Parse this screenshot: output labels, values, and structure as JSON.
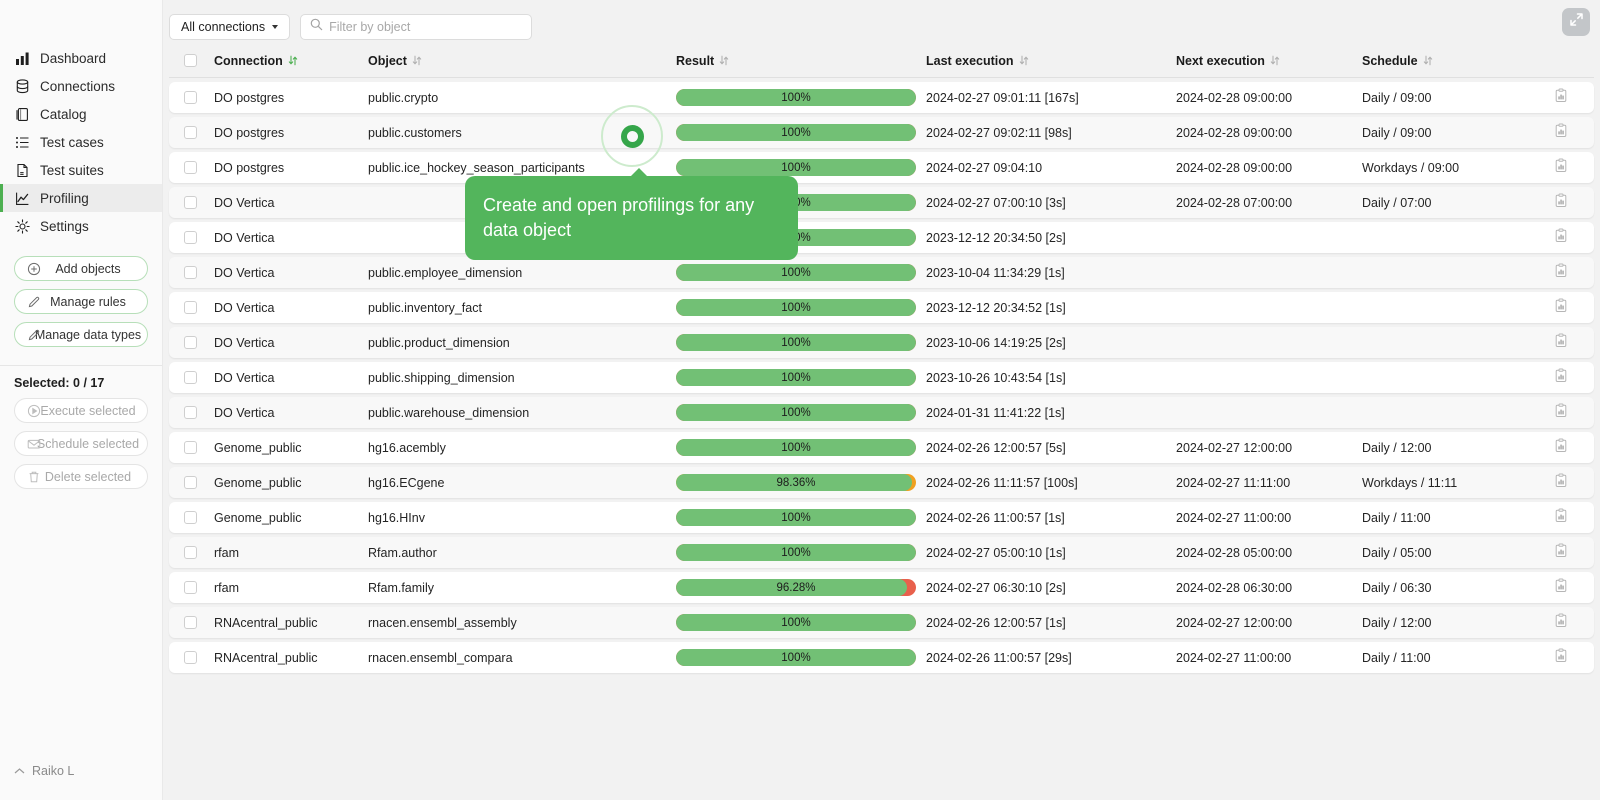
{
  "sidebar": {
    "nav_items": [
      {
        "label": "Dashboard",
        "icon": "bar-chart-icon",
        "active": false
      },
      {
        "label": "Connections",
        "icon": "database-icon",
        "active": false
      },
      {
        "label": "Catalog",
        "icon": "book-icon",
        "active": false
      },
      {
        "label": "Test cases",
        "icon": "list-icon",
        "active": false
      },
      {
        "label": "Test suites",
        "icon": "document-icon",
        "active": false
      },
      {
        "label": "Profiling",
        "icon": "line-chart-icon",
        "active": true
      },
      {
        "label": "Settings",
        "icon": "gear-icon",
        "active": false
      }
    ],
    "actions": [
      {
        "label": "Add objects",
        "icon": "plus-circle-icon",
        "enabled": true
      },
      {
        "label": "Manage rules",
        "icon": "pencil-icon",
        "enabled": true
      },
      {
        "label": "Manage data types",
        "icon": "pencil-icon",
        "enabled": true
      }
    ],
    "selected_label": "Selected: 0 / 17",
    "selection_actions": [
      {
        "label": "Execute selected",
        "icon": "play-circle-icon",
        "enabled": false
      },
      {
        "label": "Schedule selected",
        "icon": "envelope-icon",
        "enabled": false
      },
      {
        "label": "Delete selected",
        "icon": "trash-icon",
        "enabled": false
      }
    ],
    "user": {
      "name": "Raiko L",
      "icon": "chevron-up-icon"
    }
  },
  "toolbar": {
    "connection_filter_label": "All connections",
    "connection_filter_icon": "caret-down-icon",
    "search_placeholder": "Filter by object",
    "search_value": "",
    "search_icon": "search-icon",
    "expand_icon": "expand-icon"
  },
  "table": {
    "columns": [
      {
        "label": "Connection",
        "sort_icon": "sort-updown-icon",
        "sort_active": true
      },
      {
        "label": "Object",
        "sort_icon": "sort-updown-icon",
        "sort_active": false
      },
      {
        "label": "Result",
        "sort_icon": "sort-updown-icon",
        "sort_active": false
      },
      {
        "label": "Last execution",
        "sort_icon": "sort-updown-icon",
        "sort_active": false
      },
      {
        "label": "Next execution",
        "sort_icon": "sort-updown-icon",
        "sort_active": false
      },
      {
        "label": "Schedule",
        "sort_icon": "sort-updown-icon",
        "sort_active": false
      }
    ],
    "select_all_checkbox": false,
    "row_action_icon": "report-icon",
    "rows": [
      {
        "connection": "DO postgres",
        "object": "public.crypto",
        "result": "100%",
        "pct": 100,
        "last_execution": "2024-02-27 09:01:11 [167s]",
        "next_execution": "2024-02-28 09:00:00",
        "schedule": "Daily / 09:00",
        "checked": false
      },
      {
        "connection": "DO postgres",
        "object": "public.customers",
        "result": "100%",
        "pct": 100,
        "last_execution": "2024-02-27 09:02:11 [98s]",
        "next_execution": "2024-02-28 09:00:00",
        "schedule": "Daily / 09:00",
        "checked": false
      },
      {
        "connection": "DO postgres",
        "object": "public.ice_hockey_season_participants",
        "result": "100%",
        "pct": 100,
        "last_execution": "2024-02-27 09:04:10",
        "next_execution": "2024-02-28 09:00:00",
        "schedule": "Workdays / 09:00",
        "checked": false
      },
      {
        "connection": "DO Vertica",
        "object": "",
        "result": "100%",
        "pct": 100,
        "last_execution": "2024-02-27 07:00:10 [3s]",
        "next_execution": "2024-02-28 07:00:00",
        "schedule": "Daily / 07:00",
        "checked": false
      },
      {
        "connection": "DO Vertica",
        "object": "",
        "result": "100%",
        "pct": 100,
        "last_execution": "2023-12-12 20:34:50 [2s]",
        "next_execution": "",
        "schedule": "",
        "checked": false
      },
      {
        "connection": "DO Vertica",
        "object": "public.employee_dimension",
        "result": "100%",
        "pct": 100,
        "last_execution": "2023-10-04 11:34:29 [1s]",
        "next_execution": "",
        "schedule": "",
        "checked": false
      },
      {
        "connection": "DO Vertica",
        "object": "public.inventory_fact",
        "result": "100%",
        "pct": 100,
        "last_execution": "2023-12-12 20:34:52 [1s]",
        "next_execution": "",
        "schedule": "",
        "checked": false
      },
      {
        "connection": "DO Vertica",
        "object": "public.product_dimension",
        "result": "100%",
        "pct": 100,
        "last_execution": "2023-10-06 14:19:25 [2s]",
        "next_execution": "",
        "schedule": "",
        "checked": false
      },
      {
        "connection": "DO Vertica",
        "object": "public.shipping_dimension",
        "result": "100%",
        "pct": 100,
        "last_execution": "2023-10-26 10:43:54 [1s]",
        "next_execution": "",
        "schedule": "",
        "checked": false
      },
      {
        "connection": "DO Vertica",
        "object": "public.warehouse_dimension",
        "result": "100%",
        "pct": 100,
        "last_execution": "2024-01-31 11:41:22 [1s]",
        "next_execution": "",
        "schedule": "",
        "checked": false
      },
      {
        "connection": "Genome_public",
        "object": "hg16.acembly",
        "result": "100%",
        "pct": 100,
        "last_execution": "2024-02-26 12:00:57 [5s]",
        "next_execution": "2024-02-27 12:00:00",
        "schedule": "Daily / 12:00",
        "checked": false
      },
      {
        "connection": "Genome_public",
        "object": "hg16.ECgene",
        "result": "98.36%",
        "pct": 98.36,
        "last_execution": "2024-02-26 11:11:57 [100s]",
        "next_execution": "2024-02-27 11:11:00",
        "schedule": "Workdays / 11:11",
        "checked": false
      },
      {
        "connection": "Genome_public",
        "object": "hg16.HInv",
        "result": "100%",
        "pct": 100,
        "last_execution": "2024-02-26 11:00:57 [1s]",
        "next_execution": "2024-02-27 11:00:00",
        "schedule": "Daily / 11:00",
        "checked": false
      },
      {
        "connection": "rfam",
        "object": "Rfam.author",
        "result": "100%",
        "pct": 100,
        "last_execution": "2024-02-27 05:00:10 [1s]",
        "next_execution": "2024-02-28 05:00:00",
        "schedule": "Daily / 05:00",
        "checked": false
      },
      {
        "connection": "rfam",
        "object": "Rfam.family",
        "result": "96.28%",
        "pct": 96.28,
        "last_execution": "2024-02-27 06:30:10 [2s]",
        "next_execution": "2024-02-28 06:30:00",
        "schedule": "Daily / 06:30",
        "checked": false
      },
      {
        "connection": "RNAcentral_public",
        "object": "rnacen.ensembl_assembly",
        "result": "100%",
        "pct": 100,
        "last_execution": "2024-02-26 12:00:57 [1s]",
        "next_execution": "2024-02-27 12:00:00",
        "schedule": "Daily / 12:00",
        "checked": false
      },
      {
        "connection": "RNAcentral_public",
        "object": "rnacen.ensembl_compara",
        "result": "100%",
        "pct": 100,
        "last_execution": "2024-02-26 11:00:57 [29s]",
        "next_execution": "2024-02-27 11:00:00",
        "schedule": "Daily / 11:00",
        "checked": false
      }
    ]
  },
  "overlay": {
    "tooltip_text": "Create and open profilings for any data object",
    "spotlight_icon": "circle-highlight-icon"
  },
  "colors": {
    "accent_green": "#53b55c",
    "bar_green": "#72c075",
    "bar_warn": "#f0a020",
    "bar_error": "#e8604c",
    "sidebar_bg": "#fafafa",
    "page_bg": "#f2f2f2"
  }
}
